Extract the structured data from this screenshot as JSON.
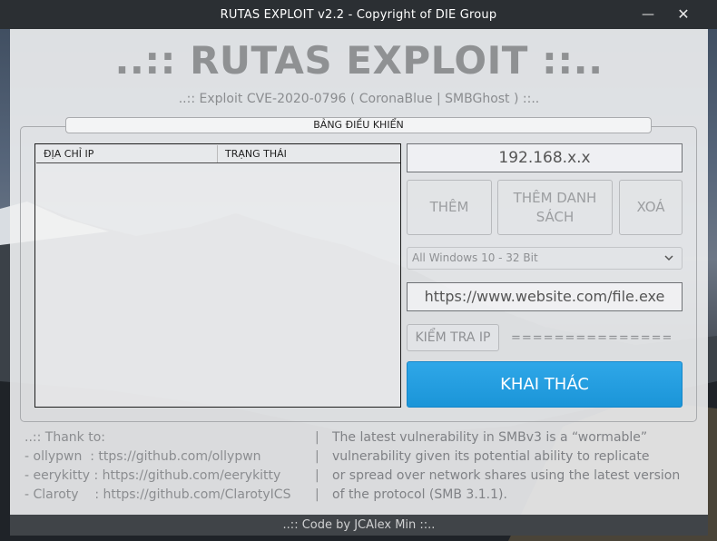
{
  "window": {
    "title": "RUTAS EXPLOIT v2.2 - Copyright of DIE Group",
    "minimize_glyph": "—",
    "close_glyph": "✕"
  },
  "header": {
    "title": "..:: RUTAS EXPLOIT ::..",
    "subtitle": "..:: Exploit CVE-2020-0796 ( CoronaBlue | SMBGhost ) ::.."
  },
  "control_panel": {
    "legend": "BẢNG ĐIỀU KHIỂN",
    "list": {
      "columns": [
        "ĐỊA CHỈ IP",
        "TRẠNG THÁI"
      ],
      "rows": []
    },
    "ip_field": {
      "value": "192.168.x.x"
    },
    "buttons": {
      "add": "THÊM",
      "add_list": "THÊM DANH SÁCH",
      "delete": "XOÁ",
      "check_ip": "KIỂM TRA IP",
      "exploit": "KHAI THÁC"
    },
    "os_select": {
      "selected": "All Windows 10 - 32 Bit"
    },
    "url_field": {
      "value": "https://www.website.com/file.exe"
    },
    "check_status": "==============="
  },
  "thanks": {
    "heading": "..:: Thank to:",
    "lines": [
      "- ollypwn  : ttps://github.com/ollypwn",
      "- eerykitty : https://github.com/eerykitty",
      "- Claroty    : https://github.com/ClarotyICS"
    ]
  },
  "description": {
    "separators": [
      "|",
      "|",
      "|",
      "|"
    ],
    "lines": [
      "The latest vulnerability in SMBv3 is a “wormable”",
      "vulnerability given its potential ability to replicate",
      "or spread over network shares using the latest version",
      "of the protocol (SMB 3.1.1)."
    ]
  },
  "footer": {
    "text": "..:: Code by JCAlex Min ::.."
  },
  "colors": {
    "accent": "#1b95d8",
    "title_gray": "#8f9193",
    "titlebar": "#2b2f33"
  }
}
